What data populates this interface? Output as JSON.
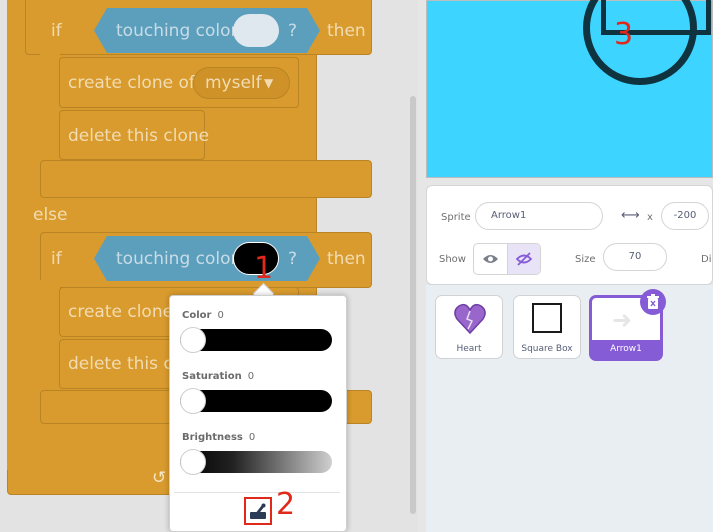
{
  "code": {
    "if_keyword": "if",
    "then_keyword": "then",
    "else_keyword": "else",
    "touching_color_label": "touching color",
    "question_mark": "?",
    "create_clone_label": "create clone of",
    "clone_target": "myself",
    "delete_clone_label": "delete this clone",
    "create_clone_label_clipped": "create clone",
    "delete_clone_label_clipped": "delete this clo"
  },
  "color_picker": {
    "color_label": "Color",
    "color_value": "0",
    "saturation_label": "Saturation",
    "saturation_value": "0",
    "brightness_label": "Brightness",
    "brightness_value": "0"
  },
  "annotations": {
    "mark1": "1",
    "mark2": "2",
    "mark3": "3"
  },
  "sprite_info": {
    "sprite_label": "Sprite",
    "sprite_name": "Arrow1",
    "x_label": "x",
    "x_value": "-200",
    "show_label": "Show",
    "size_label": "Size",
    "size_value": "70",
    "direction_label_clipped": "Di"
  },
  "sprites": [
    {
      "name": "Heart"
    },
    {
      "name": "Square Box"
    },
    {
      "name": "Arrow1",
      "selected": true
    }
  ],
  "colors": {
    "control_orange": "#d99b2d",
    "sensing_blue": "#5c9fbd",
    "stage_bg": "#3dd4ff",
    "selected_sprite": "#855cd6"
  }
}
